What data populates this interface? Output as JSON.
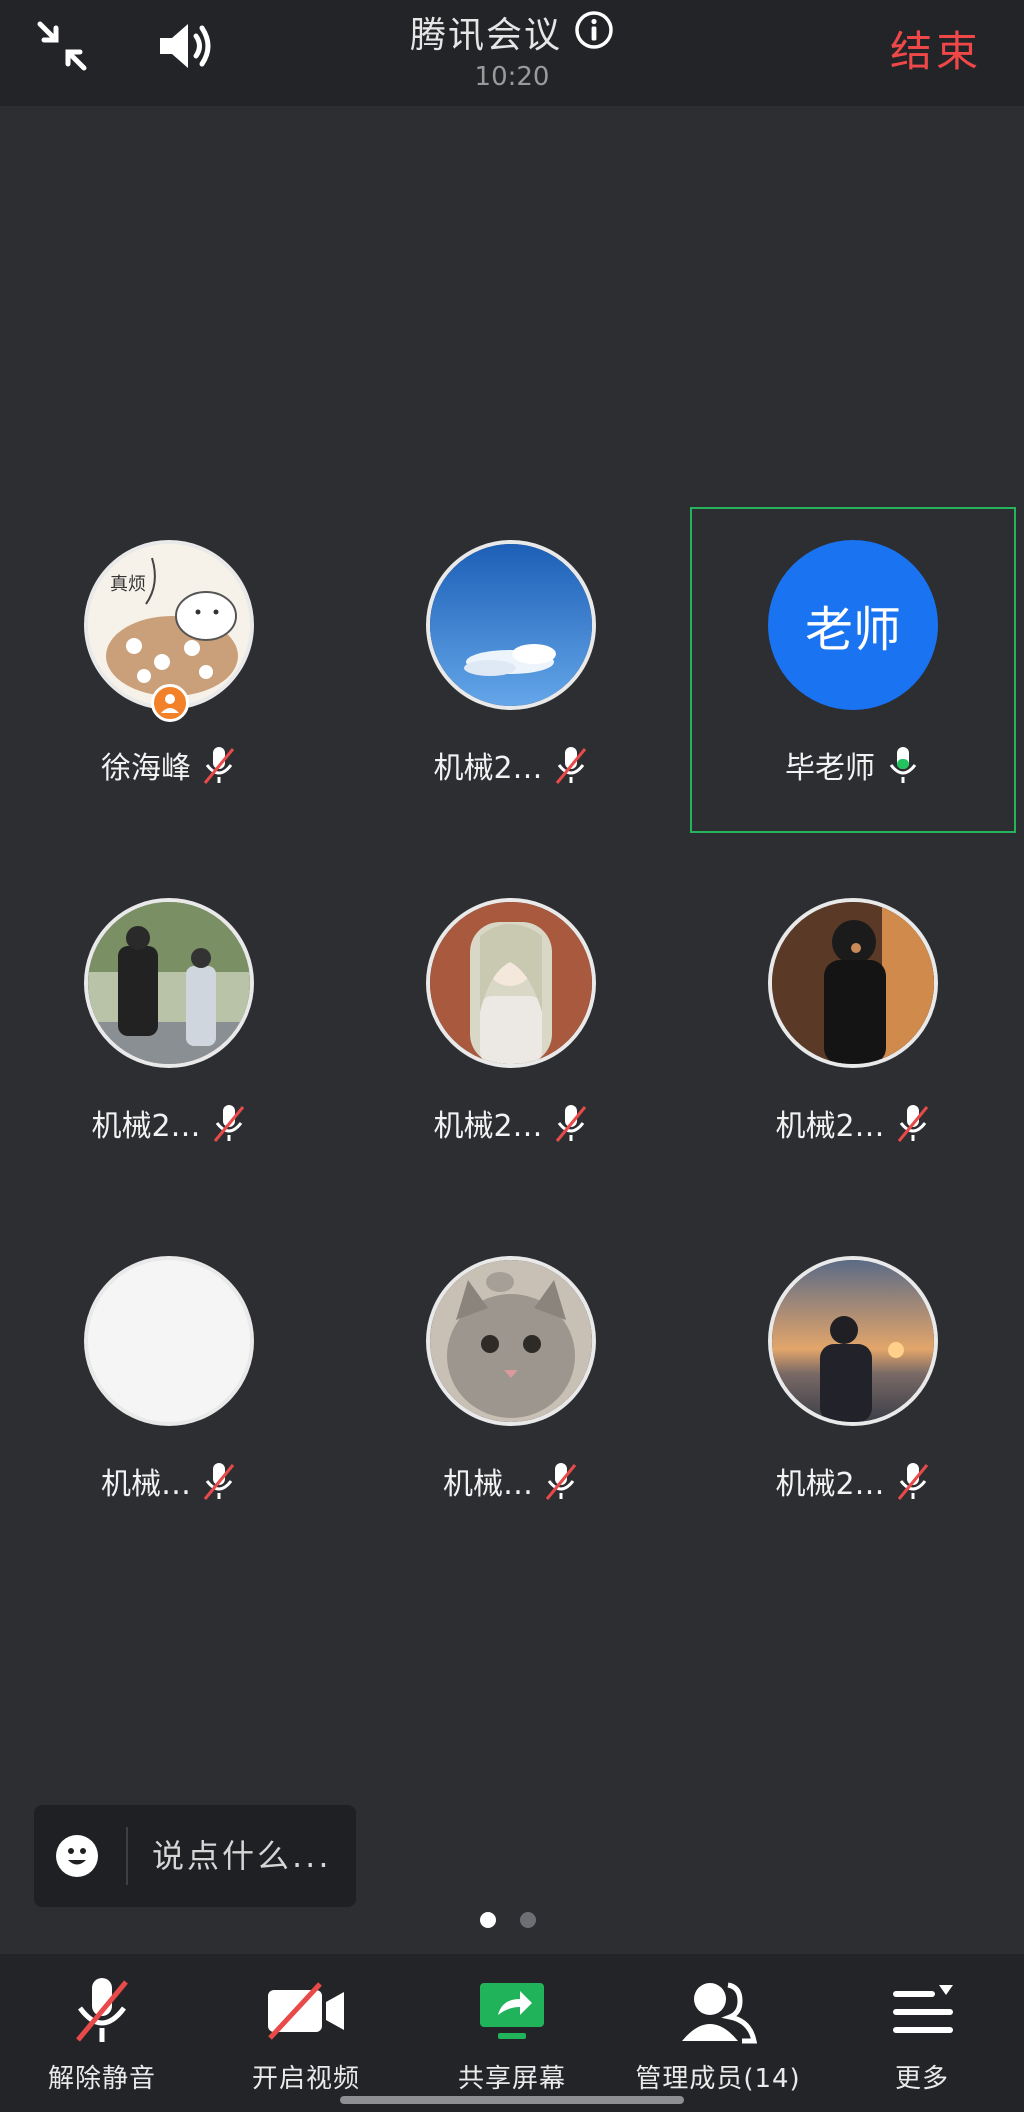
{
  "header": {
    "title": "腾讯会议",
    "time": "10:20",
    "end_label": "结束"
  },
  "participants": [
    {
      "name": "徐海峰",
      "mic": "muted",
      "avatar": "cartoon-photo",
      "host": true,
      "avatar_text": "真烦"
    },
    {
      "name": "机械2…",
      "mic": "muted",
      "avatar": "sky-photo"
    },
    {
      "name": "毕老师",
      "mic": "on",
      "avatar": "text-avatar",
      "avatar_text": "老师",
      "avatar_color": "#1a73f0",
      "active": true
    },
    {
      "name": "机械2…",
      "mic": "muted",
      "avatar": "people-photo"
    },
    {
      "name": "机械2…",
      "mic": "muted",
      "avatar": "anime-photo"
    },
    {
      "name": "机械2…",
      "mic": "muted",
      "avatar": "dark-figure-photo"
    },
    {
      "name": "机械…",
      "mic": "muted",
      "avatar": "blank-white"
    },
    {
      "name": "机械…",
      "mic": "muted",
      "avatar": "cat-photo"
    },
    {
      "name": "机械2…",
      "mic": "muted",
      "avatar": "sunset-photo"
    }
  ],
  "chat": {
    "placeholder": "说点什么..."
  },
  "pagination": {
    "pages": 2,
    "current": 1
  },
  "toolbar": [
    {
      "label": "解除静音",
      "icon": "mic-muted-icon"
    },
    {
      "label": "开启视频",
      "icon": "video-off-icon"
    },
    {
      "label": "共享屏幕",
      "icon": "share-screen-icon",
      "color": "#21b35a"
    },
    {
      "label": "管理成员(14)",
      "icon": "members-icon"
    },
    {
      "label": "更多",
      "icon": "more-icon"
    }
  ],
  "colors": {
    "end": "#f04848",
    "active_border": "#25b35c",
    "mic_on": "#22c35e",
    "mute_slash": "#e84a4a",
    "host_badge": "#f2812a"
  }
}
